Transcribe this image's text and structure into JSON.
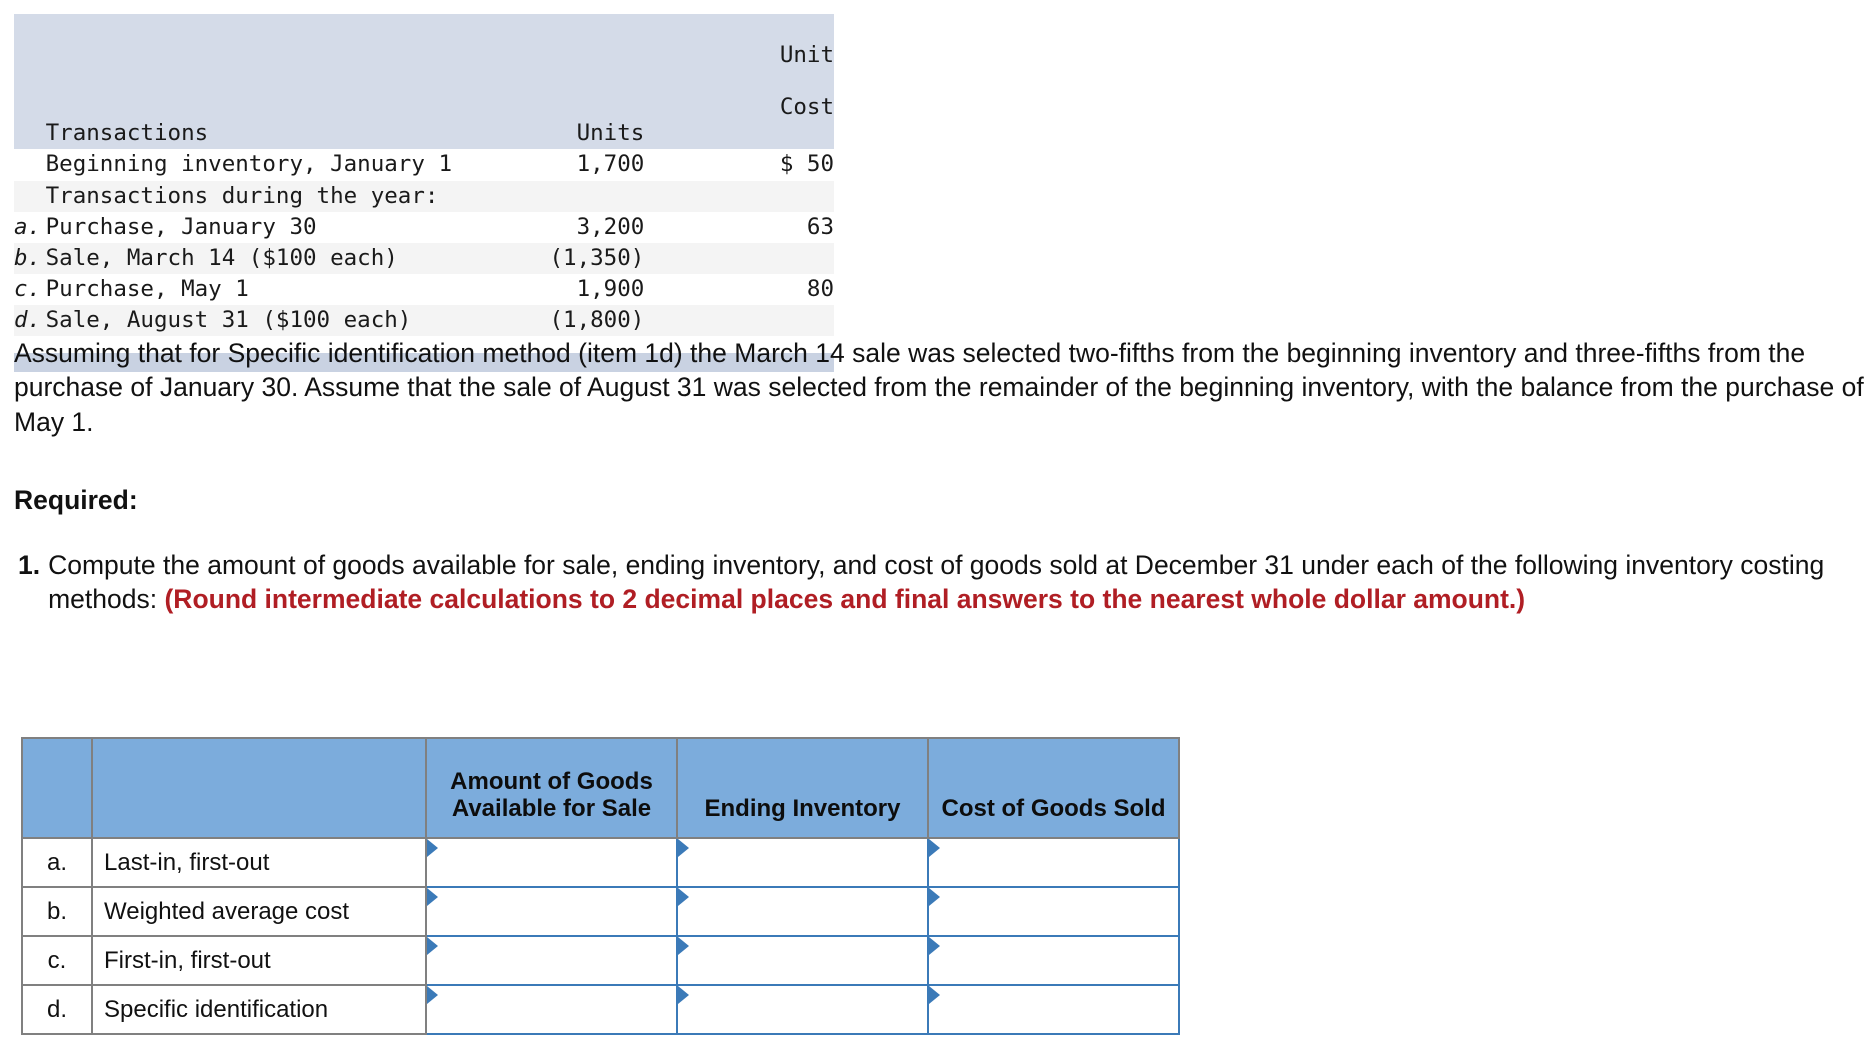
{
  "transactions_table": {
    "headers": {
      "mark": "",
      "description": "Transactions",
      "units": "Units",
      "unit_cost_line1": "Unit",
      "unit_cost_line2": "Cost"
    },
    "rows": [
      {
        "mark": "",
        "description": "Beginning inventory, January 1",
        "units": "1,700",
        "unit_cost": "$ 50"
      },
      {
        "mark": "",
        "description": "Transactions during the year:",
        "units": "",
        "unit_cost": ""
      },
      {
        "mark": "a.",
        "description": "Purchase, January 30",
        "units": "3,200",
        "unit_cost": "63"
      },
      {
        "mark": "b.",
        "description": "Sale, March 14 ($100 each)",
        "units": "(1,350)",
        "unit_cost": ""
      },
      {
        "mark": "c.",
        "description": "Purchase, May 1",
        "units": "1,900",
        "unit_cost": "80"
      },
      {
        "mark": "d.",
        "description": "Sale, August 31 ($100 each)",
        "units": "(1,800)",
        "unit_cost": ""
      }
    ]
  },
  "assumption_paragraph": "Assuming that for Specific identification method (item 1d) the March 14 sale was selected two-fifths from the beginning inventory and three-fifths from the purchase of January 30. Assume that the sale of August 31 was selected from the remainder of the beginning inventory, with the balance from the purchase of May 1.",
  "required": {
    "heading": "Required:",
    "item_number": "1.",
    "item_text_plain": "Compute the amount of goods available for sale, ending inventory, and cost of goods sold at December 31 under each of the following inventory costing methods: ",
    "item_text_emphasis": "(Round intermediate calculations to 2 decimal places and final answers to the nearest whole dollar amount.)"
  },
  "answer_table": {
    "headers": {
      "letter_col": "",
      "method_col": "",
      "goods_available": "Amount of Goods Available for Sale",
      "ending_inventory": "Ending Inventory",
      "cost_of_goods_sold": "Cost of Goods Sold"
    },
    "rows": [
      {
        "letter": "a.",
        "method": "Last-in, first-out",
        "goods_available": "",
        "ending_inventory": "",
        "cost_of_goods_sold": ""
      },
      {
        "letter": "b.",
        "method": "Weighted average cost",
        "goods_available": "",
        "ending_inventory": "",
        "cost_of_goods_sold": ""
      },
      {
        "letter": "c.",
        "method": "First-in, first-out",
        "goods_available": "",
        "ending_inventory": "",
        "cost_of_goods_sold": ""
      },
      {
        "letter": "d.",
        "method": "Specific identification",
        "goods_available": "",
        "ending_inventory": "",
        "cost_of_goods_sold": ""
      }
    ]
  },
  "colors": {
    "txn_header_bg": "#d4dbe8",
    "txn_footer_bg": "#c9d2e2",
    "txn_row_alt_bg": "#f4f4f4",
    "answer_header_bg": "#7cacdc",
    "answer_border": "#808080",
    "input_border": "#3b7ab8",
    "emphasis_red": "#b01e24"
  }
}
